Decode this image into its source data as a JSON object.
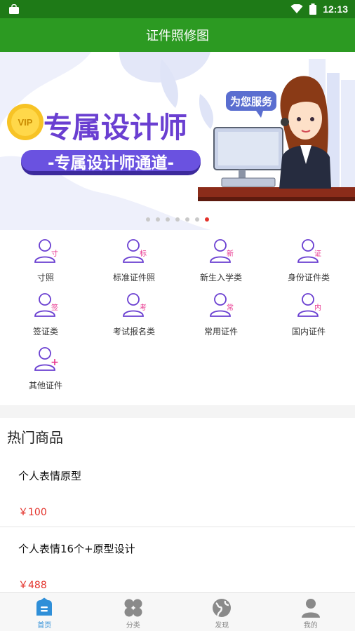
{
  "status_bar": {
    "time": "12:13"
  },
  "app_bar": {
    "title": "证件照修图"
  },
  "banner": {
    "headline": "专属设计师",
    "subline": "-专属设计师通道-",
    "bubble": "为您服务",
    "coin_text": "VIP",
    "slide_count": 7,
    "active_slide": 7
  },
  "categories": [
    {
      "label": "寸照",
      "badge": "寸"
    },
    {
      "label": "标准证件照",
      "badge": "标"
    },
    {
      "label": "新生入学类",
      "badge": "新"
    },
    {
      "label": "身份证件类",
      "badge": "证"
    },
    {
      "label": "签证类",
      "badge": "签"
    },
    {
      "label": "考试报名类",
      "badge": "考"
    },
    {
      "label": "常用证件",
      "badge": "常"
    },
    {
      "label": "国内证件",
      "badge": "内"
    },
    {
      "label": "其他证件",
      "badge": "+"
    }
  ],
  "hot": {
    "title": "热门商品",
    "products": [
      {
        "name": "个人表情原型",
        "price": "￥100"
      },
      {
        "name": "个人表情16个+原型设计",
        "price": "￥488"
      }
    ]
  },
  "tabbar": {
    "items": [
      {
        "label": "首页",
        "icon": "home-icon",
        "active": true
      },
      {
        "label": "分类",
        "icon": "category-icon",
        "active": false
      },
      {
        "label": "发现",
        "icon": "globe-icon",
        "active": false
      },
      {
        "label": "我的",
        "icon": "user-icon",
        "active": false
      }
    ]
  },
  "colors": {
    "status_bar": "#1e7a17",
    "app_bar": "#2c9a22",
    "accent_purple": "#6a3fd1",
    "badge_pink": "#e8368f",
    "price_red": "#e3312a",
    "tab_active": "#2f8fd8"
  }
}
